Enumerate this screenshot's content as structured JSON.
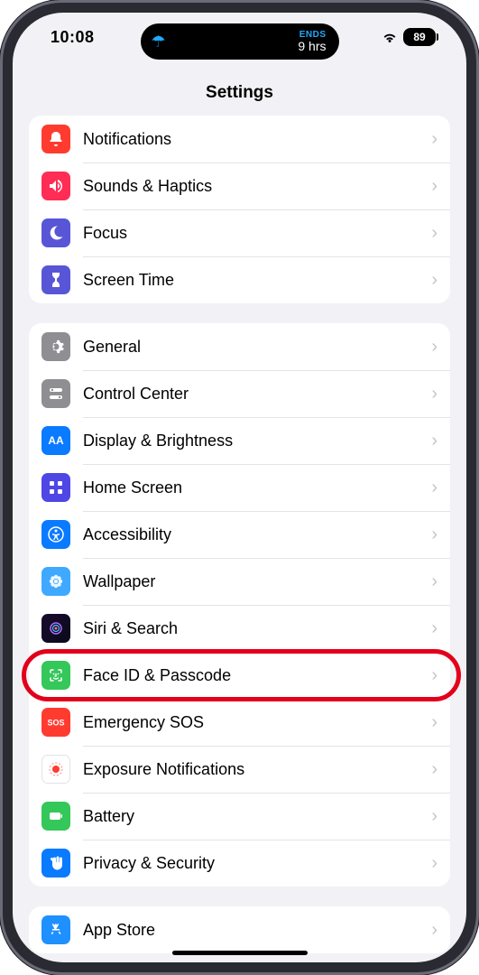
{
  "status": {
    "time": "10:08",
    "island_ends_label": "ENDS",
    "island_hours": "9 hrs",
    "battery": "89"
  },
  "nav": {
    "title": "Settings"
  },
  "groups": [
    {
      "rows": [
        {
          "key": "notifications",
          "label": "Notifications",
          "icon": "bell-icon",
          "color": "c-red"
        },
        {
          "key": "sounds",
          "label": "Sounds & Haptics",
          "icon": "speaker-icon",
          "color": "c-pink"
        },
        {
          "key": "focus",
          "label": "Focus",
          "icon": "moon-icon",
          "color": "c-indigo"
        },
        {
          "key": "screentime",
          "label": "Screen Time",
          "icon": "hourglass-icon",
          "color": "c-indigo"
        }
      ]
    },
    {
      "rows": [
        {
          "key": "general",
          "label": "General",
          "icon": "gear-icon",
          "color": "c-gray"
        },
        {
          "key": "controlcenter",
          "label": "Control Center",
          "icon": "toggles-icon",
          "color": "c-gray"
        },
        {
          "key": "display",
          "label": "Display & Brightness",
          "icon": "aa-icon",
          "color": "c-blue"
        },
        {
          "key": "homescreen",
          "label": "Home Screen",
          "icon": "grid-icon",
          "color": "c-hs"
        },
        {
          "key": "accessibility",
          "label": "Accessibility",
          "icon": "accessibility-icon",
          "color": "c-blue"
        },
        {
          "key": "wallpaper",
          "label": "Wallpaper",
          "icon": "flower-icon",
          "color": "c-lightblue"
        },
        {
          "key": "siri",
          "label": "Siri & Search",
          "icon": "siri-icon",
          "color": "c-siri"
        },
        {
          "key": "faceid",
          "label": "Face ID & Passcode",
          "icon": "faceid-icon",
          "color": "c-green",
          "highlighted": true
        },
        {
          "key": "sos",
          "label": "Emergency SOS",
          "icon": "sos-icon",
          "color": "c-sosred"
        },
        {
          "key": "exposure",
          "label": "Exposure Notifications",
          "icon": "exposure-icon",
          "color": "c-white"
        },
        {
          "key": "battery",
          "label": "Battery",
          "icon": "battery-icon",
          "color": "c-green"
        },
        {
          "key": "privacy",
          "label": "Privacy & Security",
          "icon": "hand-icon",
          "color": "c-blue"
        }
      ]
    },
    {
      "rows": [
        {
          "key": "appstore",
          "label": "App Store",
          "icon": "appstore-icon",
          "color": "c-appstore"
        }
      ]
    }
  ]
}
